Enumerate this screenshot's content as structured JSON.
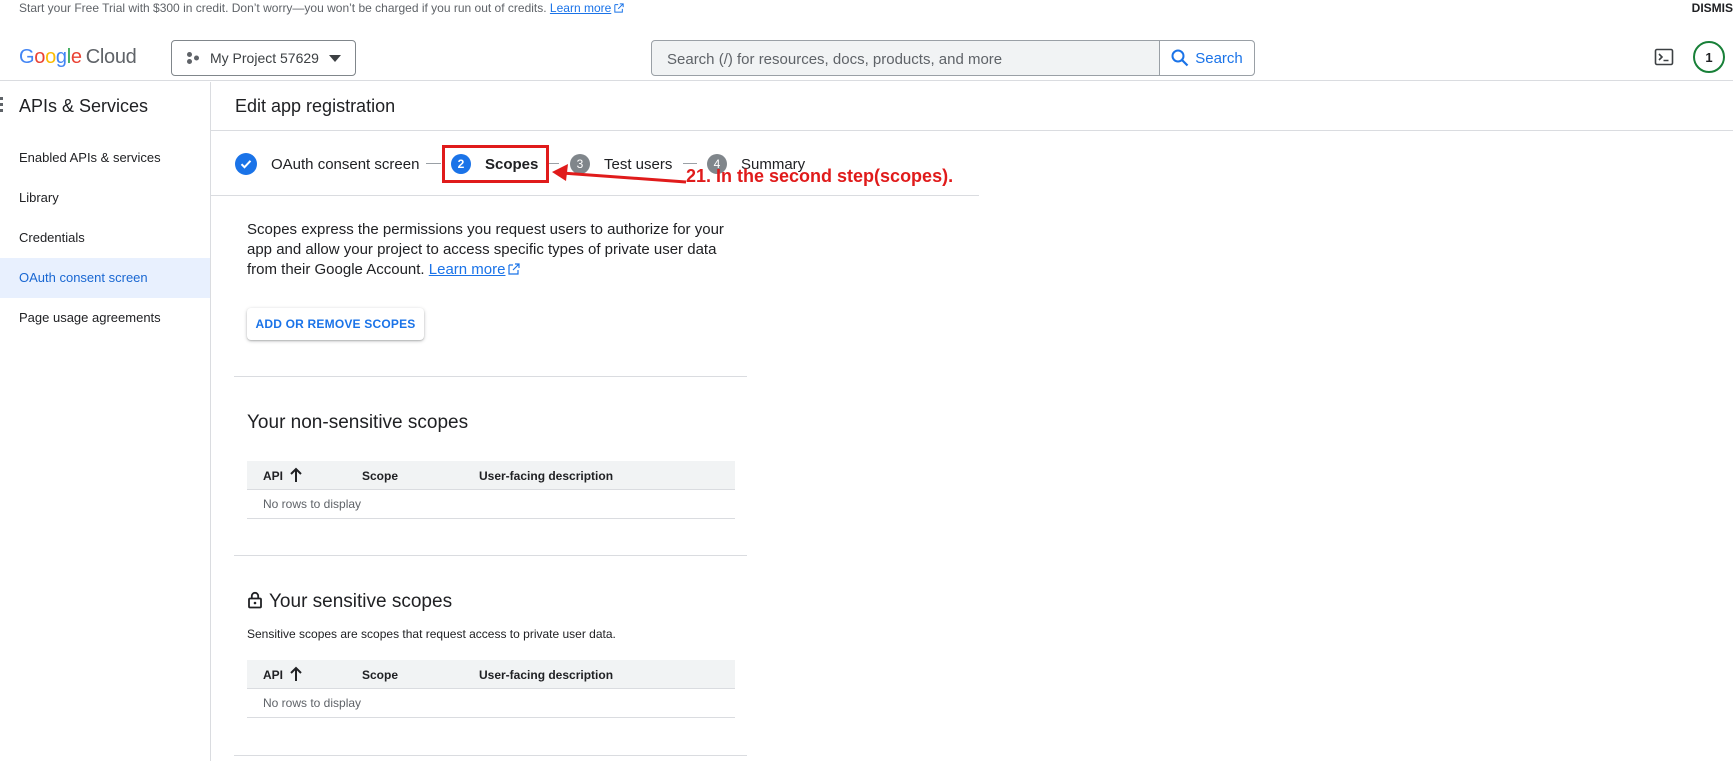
{
  "banner": {
    "text": "Start your Free Trial with $300 in credit. Don’t worry—you won’t be charged if you run out of credits.",
    "link": "Learn more",
    "dismiss": "DISMIS"
  },
  "header": {
    "logo_google": [
      "G",
      "o",
      "o",
      "g",
      "l",
      "e"
    ],
    "logo_cloud": "Cloud",
    "project": "My Project 57629",
    "search_placeholder": "Search (/) for resources, docs, products, and more",
    "search_button": "Search",
    "avatar": "1"
  },
  "sidebar": {
    "title": "APIs & Services",
    "items": [
      {
        "label": "Enabled APIs & services"
      },
      {
        "label": "Library"
      },
      {
        "label": "Credentials"
      },
      {
        "label": "OAuth consent screen",
        "active": true
      },
      {
        "label": "Page usage agreements"
      }
    ]
  },
  "page": {
    "title": "Edit app registration"
  },
  "stepper": {
    "steps": [
      {
        "num": "",
        "label": "OAuth consent screen",
        "state": "done"
      },
      {
        "num": "2",
        "label": "Scopes",
        "state": "current"
      },
      {
        "num": "3",
        "label": "Test users",
        "state": "todo"
      },
      {
        "num": "4",
        "label": "Summary",
        "state": "todo"
      }
    ]
  },
  "annotation": {
    "text": "21. In the second step(scopes).",
    "color": "#e01b1b"
  },
  "scopes": {
    "description": "Scopes express the permissions you request users to authorize for your app and allow your project to access specific types of private user data from their Google Account.",
    "learn_more": "Learn more",
    "add_button": "ADD OR REMOVE SCOPES",
    "non_sensitive": {
      "title": "Your non-sensitive scopes",
      "columns": [
        "API",
        "Scope",
        "User-facing description"
      ],
      "empty": "No rows to display"
    },
    "sensitive": {
      "title": "Your sensitive scopes",
      "subtitle": "Sensitive scopes are scopes that request access to private user data.",
      "columns": [
        "API",
        "Scope",
        "User-facing description"
      ],
      "empty": "No rows to display"
    }
  },
  "colors": {
    "accent": "#1a73e8",
    "active_bg": "#e8f0fe"
  }
}
